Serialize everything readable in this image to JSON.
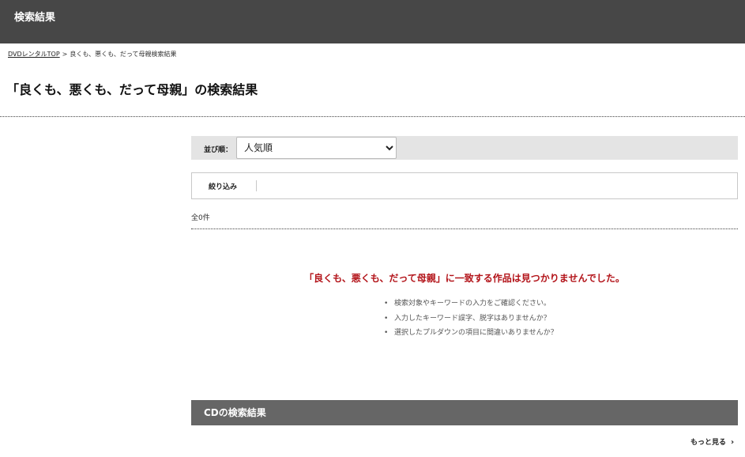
{
  "header": {
    "title": "検索結果"
  },
  "breadcrumb": {
    "home_label": "DVDレンタルTOP",
    "separator": ">",
    "current": "良くも、悪くも、だって母親検索結果"
  },
  "page": {
    "title": "「良くも、悪くも、だって母親」の検索結果"
  },
  "sort": {
    "label": "並び順：",
    "selected": "人気順",
    "options": [
      "人気順"
    ]
  },
  "filter": {
    "label": "絞り込み"
  },
  "results": {
    "count_text": "全0件",
    "no_result_message": "「良くも、悪くも、だって母親」に一致する作品は見つかりませんでした。",
    "tips": [
      "検索対象やキーワードの入力をご確認ください。",
      "入力したキーワード誤字、脱字はありませんか？",
      "選択したプルダウンの項目に間違いありませんか？"
    ],
    "tip_bullet": "•"
  },
  "cd_section": {
    "title": "CDの検索結果",
    "more_label": "もっと見る",
    "more_icon": "chevron-right-icon"
  },
  "colors": {
    "header_bg": "#474747",
    "accent_red": "#b3141a",
    "section_bg": "#666666",
    "sort_bar_bg": "#e4e4e4"
  }
}
